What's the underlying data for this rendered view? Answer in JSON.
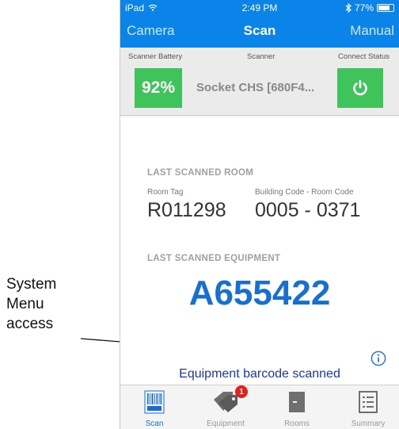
{
  "annotation": {
    "lines": [
      "System",
      "Menu",
      "access"
    ]
  },
  "status_bar": {
    "device": "iPad",
    "time": "2:49 PM",
    "battery_text": "77%",
    "battery_level": 0.77
  },
  "nav": {
    "left": "Camera",
    "title": "Scan",
    "right": "Manual"
  },
  "scanner": {
    "battery_label": "Scanner Battery",
    "battery_value": "92%",
    "scanner_label": "Scanner",
    "scanner_name": "Socket CHS [680F4...",
    "connect_label": "Connect Status",
    "connect_icon": "power-icon"
  },
  "room": {
    "heading": "LAST SCANNED ROOM",
    "tag_label": "Room Tag",
    "tag_value": "R011298",
    "code_label": "Building Code - Room Code",
    "code_value": "0005 - 0371"
  },
  "equipment": {
    "heading": "LAST SCANNED EQUIPMENT",
    "code": "A655422"
  },
  "status_message": "Equipment barcode scanned",
  "tabs": [
    {
      "label": "Scan",
      "icon": "barcode-icon",
      "active": true
    },
    {
      "label": "Equipment",
      "icon": "tag-icon",
      "badge": "1"
    },
    {
      "label": "Rooms",
      "icon": "door-icon"
    },
    {
      "label": "Summary",
      "icon": "list-icon"
    }
  ],
  "colors": {
    "accent": "#0a84e8",
    "status_green": "#3fc45c",
    "code_blue": "#1670d4",
    "badge_red": "#e0201b"
  }
}
